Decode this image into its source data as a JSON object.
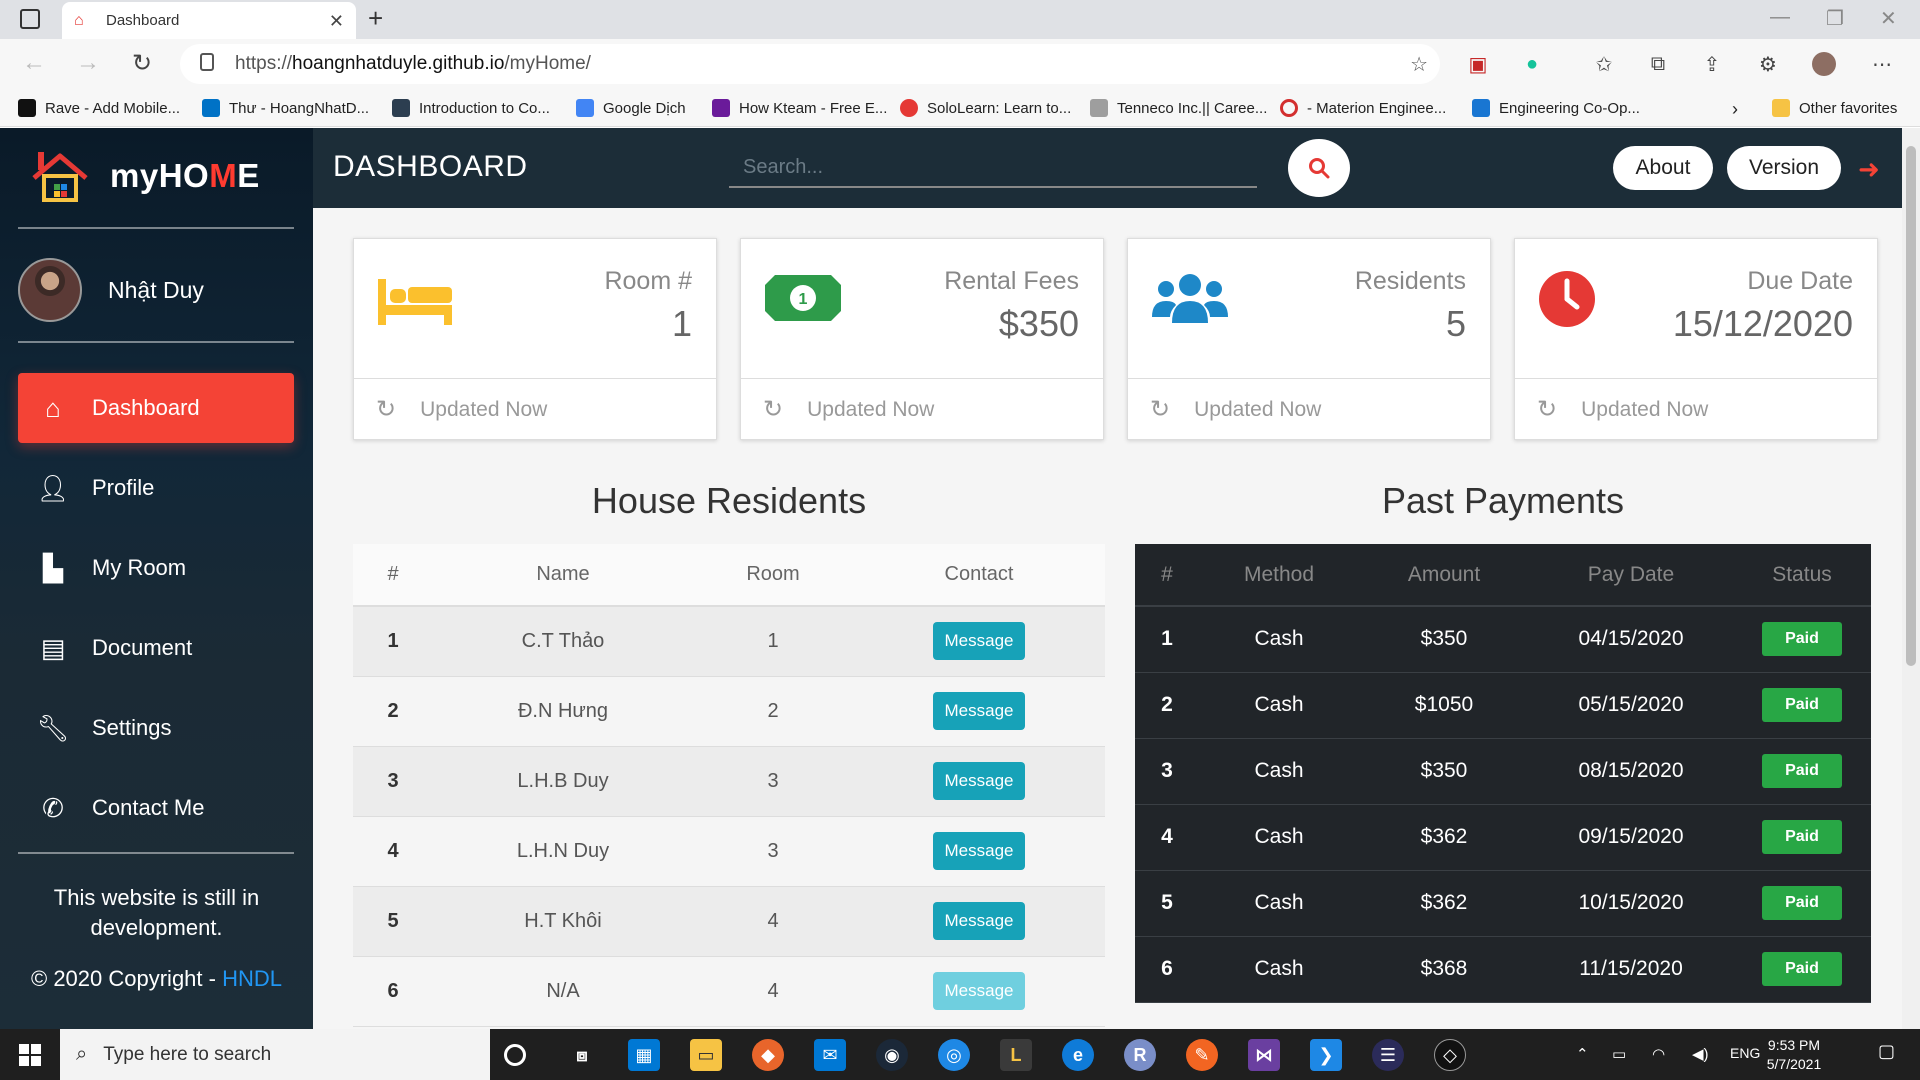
{
  "browser": {
    "tab_title": "Dashboard",
    "url_prefix": "https://",
    "url_host": "hoangnhatduyle.github.io",
    "url_path": "/myHome/",
    "bookmarks": [
      {
        "label": "Rave - Add Mobile...",
        "color": "#111111"
      },
      {
        "label": "Thư - HoangNhatD...",
        "color": "#0072c6"
      },
      {
        "label": "Introduction to Co...",
        "color": "#2c3e50"
      },
      {
        "label": "Google Dịch",
        "color": "#4285f4"
      },
      {
        "label": "How Kteam - Free E...",
        "color": "#6a1b9a"
      },
      {
        "label": "SoloLearn: Learn to...",
        "color": "#e53935"
      },
      {
        "label": "Tenneco Inc.|| Caree...",
        "color": "#9e9e9e"
      },
      {
        "label": "- Materion Enginee...",
        "color": "#d32f2f"
      },
      {
        "label": "Engineering Co-Op...",
        "color": "#1976d2"
      }
    ],
    "other_favorites": "Other favorites"
  },
  "sidebar": {
    "brand_prefix": "my",
    "brand_o": "HO",
    "brand_highlight": "M",
    "brand_suffix": "E",
    "user_name": "Nhật Duy",
    "items": [
      {
        "label": "Dashboard",
        "icon": "home-icon",
        "active": true
      },
      {
        "label": "Profile",
        "icon": "user-icon",
        "active": false
      },
      {
        "label": "My Room",
        "icon": "door-icon",
        "active": false
      },
      {
        "label": "Document",
        "icon": "file-icon",
        "active": false
      },
      {
        "label": "Settings",
        "icon": "wrench-icon",
        "active": false
      },
      {
        "label": "Contact Me",
        "icon": "phone-icon",
        "active": false
      }
    ],
    "footer_note": "This website is still in development.",
    "copyright_prefix": "© 2020 Copyright - ",
    "copyright_link": "HNDL"
  },
  "topbar": {
    "title": "DASHBOARD",
    "search_placeholder": "Search...",
    "about_label": "About",
    "version_label": "Version"
  },
  "cards": [
    {
      "title": "Room #",
      "value": "1",
      "icon": "bed-icon",
      "color": "#fbc02d",
      "footer": "Updated Now"
    },
    {
      "title": "Rental Fees",
      "value": "$350",
      "icon": "money-icon",
      "color": "#2e9b4a",
      "footer": "Updated Now"
    },
    {
      "title": "Residents",
      "value": "5",
      "icon": "users-icon",
      "color": "#1e88c8",
      "footer": "Updated Now"
    },
    {
      "title": "Due Date",
      "value": "15/12/2020",
      "icon": "clock-icon",
      "color": "#e53935",
      "footer": "Updated Now"
    }
  ],
  "residents": {
    "title": "House Residents",
    "headers": [
      "#",
      "Name",
      "Room",
      "Contact"
    ],
    "button_label": "Message",
    "rows": [
      {
        "num": "1",
        "name": "C.T Thảo",
        "room": "1"
      },
      {
        "num": "2",
        "name": "Đ.N Hưng",
        "room": "2"
      },
      {
        "num": "3",
        "name": "L.H.B Duy",
        "room": "3"
      },
      {
        "num": "4",
        "name": "L.H.N Duy",
        "room": "3"
      },
      {
        "num": "5",
        "name": "H.T Khôi",
        "room": "4"
      },
      {
        "num": "6",
        "name": "N/A",
        "room": "4"
      }
    ]
  },
  "payments": {
    "title": "Past Payments",
    "headers": [
      "#",
      "Method",
      "Amount",
      "Pay Date",
      "Status"
    ],
    "rows": [
      {
        "num": "1",
        "method": "Cash",
        "amount": "$350",
        "date": "04/15/2020",
        "status": "Paid"
      },
      {
        "num": "2",
        "method": "Cash",
        "amount": "$1050",
        "date": "05/15/2020",
        "status": "Paid"
      },
      {
        "num": "3",
        "method": "Cash",
        "amount": "$350",
        "date": "08/15/2020",
        "status": "Paid"
      },
      {
        "num": "4",
        "method": "Cash",
        "amount": "$362",
        "date": "09/15/2020",
        "status": "Paid"
      },
      {
        "num": "5",
        "method": "Cash",
        "amount": "$362",
        "date": "10/15/2020",
        "status": "Paid"
      },
      {
        "num": "6",
        "method": "Cash",
        "amount": "$368",
        "date": "11/15/2020",
        "status": "Paid"
      }
    ]
  },
  "taskbar": {
    "search_placeholder": "Type here to search",
    "lang": "ENG",
    "time": "9:53 PM",
    "date": "5/7/2021"
  }
}
